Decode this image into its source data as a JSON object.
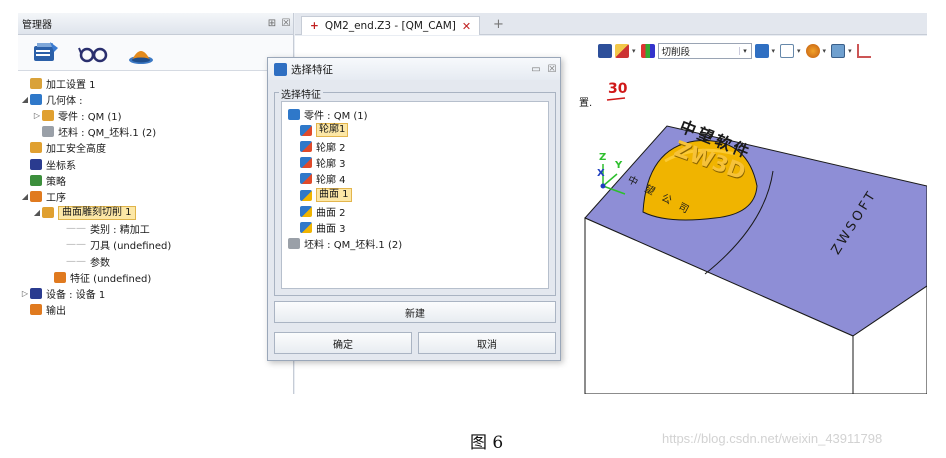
{
  "manager": {
    "title": "管理器",
    "pin": "⊞",
    "close": "☒",
    "tabs": [
      {
        "icon": "cam-plan-icon"
      },
      {
        "icon": "glasses-icon"
      },
      {
        "icon": "machine-view-icon"
      }
    ],
    "tree": [
      {
        "label": "加工设置 1",
        "indent": 0,
        "toggle": "",
        "icon": "folder-icon",
        "color": "#d9a23a"
      },
      {
        "label": "几何体 :",
        "indent": 0,
        "toggle": "◢",
        "icon": "geometry-icon",
        "color": "#2f78c9"
      },
      {
        "label": "零件 : QM (1)",
        "indent": 1,
        "toggle": "▷",
        "icon": "part-icon",
        "color": "#e0a030"
      },
      {
        "label": "坯料 : QM_坯料.1 (2)",
        "indent": 1,
        "toggle": "",
        "icon": "stock-icon",
        "color": "#9aa0a8"
      },
      {
        "label": "加工安全高度",
        "indent": 0,
        "toggle": "",
        "icon": "safe-height-icon",
        "color": "#e0a030"
      },
      {
        "label": "坐标系",
        "indent": 0,
        "toggle": "",
        "icon": "coordinate-icon",
        "color": "#2a3b8f"
      },
      {
        "label": "策略",
        "indent": 0,
        "toggle": "",
        "icon": "strategy-icon",
        "color": "#3c8f3c"
      },
      {
        "label": "工序",
        "indent": 0,
        "toggle": "◢",
        "icon": "operation-icon",
        "color": "#e07a1f"
      },
      {
        "label": "曲面雕刻切削 1",
        "indent": 1,
        "toggle": "◢",
        "icon": "surface-cut-icon",
        "color": "#e0a030",
        "selected": true
      },
      {
        "label": "类别 : 精加工",
        "indent": 3,
        "toggle": "",
        "icon": "",
        "dash": true
      },
      {
        "label": "刀具 (undefined)",
        "indent": 3,
        "toggle": "",
        "icon": "",
        "dash": true
      },
      {
        "label": "参数",
        "indent": 3,
        "toggle": "",
        "icon": "",
        "dash": true
      },
      {
        "label": "特征 (undefined)",
        "indent": 2,
        "toggle": "",
        "icon": "feature-icon",
        "color": "#e07a1f"
      },
      {
        "label": "设备 : 设备 1",
        "indent": 0,
        "toggle": "▷",
        "icon": "equipment-icon",
        "color": "#2a3b8f"
      },
      {
        "label": "输出",
        "indent": 0,
        "toggle": "",
        "icon": "output-icon",
        "color": "#e07a1f"
      }
    ]
  },
  "editor": {
    "tab_label": "QM2_end.Z3 - [QM_CAM]",
    "tab_close": "✕",
    "new_tab": "+",
    "toolbar": {
      "filter_value": "切削段",
      "icons": [
        "feature-tool-icon",
        "pencil-icon",
        "bar-chart-icon",
        "cube-color-icon",
        "cube-wire-icon",
        "render-icon",
        "view-icon",
        "more-icon"
      ]
    },
    "viewport": {
      "partial_label": "置.",
      "marker": "30",
      "axis_x": "X",
      "axis_y": "Y",
      "axis_z": "Z",
      "text_top": "中望软件",
      "text_dome": "ZW3D",
      "text_front": "中 望 公 司",
      "text_side": "ZWSOFT",
      "colors": {
        "block_top": "#8e8ed6",
        "block_side": "#ffffff",
        "dome": "#f0b400",
        "edge": "#1a1a1a"
      }
    }
  },
  "dialog": {
    "title": "选择特征",
    "pin": "▭",
    "close": "☒",
    "group_label": "选择特征",
    "items": [
      {
        "label": "零件 : QM (1)",
        "indent": 0,
        "icon": "part-icon",
        "color": "#2f78c9"
      },
      {
        "label": "轮廓1",
        "indent": 1,
        "icon": "contour-icon",
        "color": "#2f78c9",
        "selected": true
      },
      {
        "label": "轮廓 2",
        "indent": 1,
        "icon": "contour-icon",
        "color": "#2f78c9"
      },
      {
        "label": "轮廓 3",
        "indent": 1,
        "icon": "contour-icon",
        "color": "#2f78c9"
      },
      {
        "label": "轮廓 4",
        "indent": 1,
        "icon": "contour-icon",
        "color": "#2f78c9"
      },
      {
        "label": "曲面 1",
        "indent": 1,
        "icon": "surface-icon",
        "color": "#2f78c9",
        "selected": true
      },
      {
        "label": "曲面 2",
        "indent": 1,
        "icon": "surface-icon",
        "color": "#2f78c9"
      },
      {
        "label": "曲面 3",
        "indent": 1,
        "icon": "surface-icon",
        "color": "#2f78c9"
      },
      {
        "label": "坯料 : QM_坯料.1 (2)",
        "indent": 0,
        "icon": "stock-icon",
        "color": "#9aa0a8"
      }
    ],
    "new_button": "新建",
    "ok_button": "确定",
    "cancel_button": "取消"
  },
  "caption": "图 6",
  "watermark": "https://blog.csdn.net/weixin_43911798"
}
